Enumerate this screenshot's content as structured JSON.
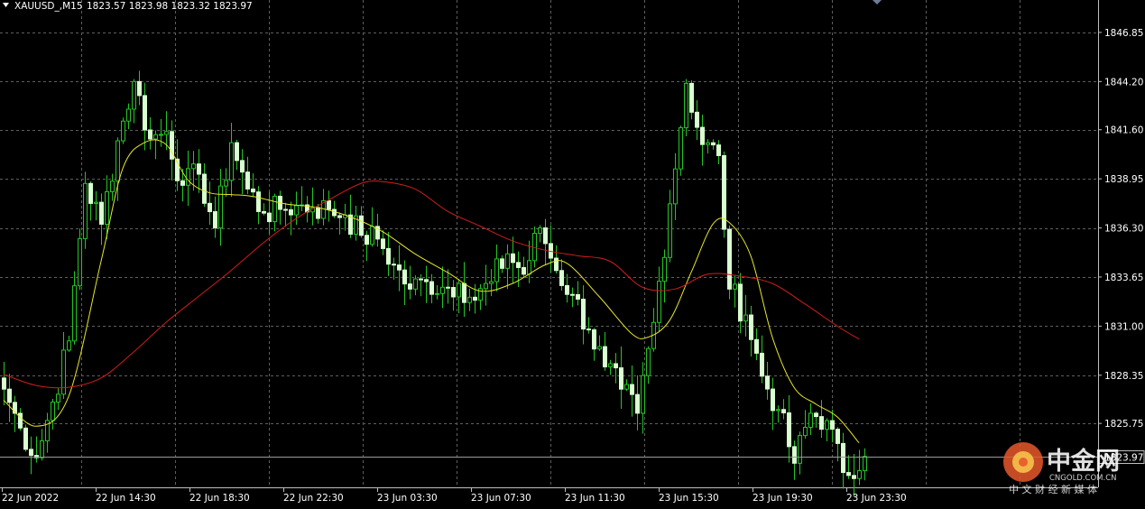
{
  "header": {
    "symbol_label": "XAUUSD_,M15",
    "ohlc_text": "1823.57 1823.98 1823.32 1823.97"
  },
  "colors": {
    "background": "#000000",
    "grid": "#5f5f5f",
    "up": "#22c622",
    "down": "#d9ffd0",
    "ma_fast": "#e6e62a",
    "ma_slow": "#d01d1d",
    "price_line": "#9a9a9a"
  },
  "watermark": {
    "name": "中金网",
    "domain": "CNGOLD.COM.CN",
    "slogan": "中 文 财 经 新 媒 体"
  },
  "chart_data": {
    "type": "candlestick",
    "symbol": "XAUUSD_",
    "timeframe": "M15",
    "y_ticks": [
      1846.85,
      1844.2,
      1841.6,
      1838.95,
      1836.3,
      1833.65,
      1831.0,
      1828.35,
      1825.75
    ],
    "y_tick_labels": [
      "1846.85",
      "1844.20",
      "1841.60",
      "1838.95",
      "1836.30",
      "1833.65",
      "1831.00",
      "1828.35",
      "1825.75"
    ],
    "ylim": [
      1822.3,
      1848.6
    ],
    "current_price": 1823.97,
    "current_price_label": "1823.97",
    "x_tick_labels": [
      "22 Jun 2022",
      "22 Jun 14:30",
      "22 Jun 18:30",
      "22 Jun 22:30",
      "23 Jun 03:30",
      "23 Jun 07:30",
      "23 Jun 11:30",
      "23 Jun 15:30",
      "23 Jun 19:30",
      "23 Jun 23:30"
    ],
    "candle_count": 160,
    "close_anchors": [
      [
        0,
        1827.6
      ],
      [
        3,
        1825.5
      ],
      [
        6,
        1823.9
      ],
      [
        9,
        1826.9
      ],
      [
        12,
        1830.2
      ],
      [
        15,
        1838.7
      ],
      [
        18,
        1836.5
      ],
      [
        21,
        1841.0
      ],
      [
        24,
        1844.2
      ],
      [
        27,
        1841.1
      ],
      [
        30,
        1841.5
      ],
      [
        33,
        1838.6
      ],
      [
        36,
        1839.2
      ],
      [
        39,
        1836.3
      ],
      [
        42,
        1840.9
      ],
      [
        45,
        1838.4
      ],
      [
        48,
        1837.1
      ],
      [
        51,
        1837.3
      ],
      [
        54,
        1837.5
      ],
      [
        57,
        1837.4
      ],
      [
        60,
        1837.3
      ],
      [
        63,
        1837.0
      ],
      [
        66,
        1835.9
      ],
      [
        69,
        1835.7
      ],
      [
        72,
        1834.3
      ],
      [
        75,
        1833.0
      ],
      [
        78,
        1833.4
      ],
      [
        81,
        1833.1
      ],
      [
        84,
        1833.3
      ],
      [
        87,
        1832.4
      ],
      [
        90,
        1833.4
      ],
      [
        93,
        1834.9
      ],
      [
        96,
        1833.8
      ],
      [
        99,
        1836.3
      ],
      [
        102,
        1834.0
      ],
      [
        105,
        1832.7
      ],
      [
        108,
        1830.8
      ],
      [
        111,
        1828.8
      ],
      [
        114,
        1827.6
      ],
      [
        117,
        1826.3
      ],
      [
        120,
        1831.2
      ],
      [
        123,
        1837.6
      ],
      [
        126,
        1844.1
      ],
      [
        129,
        1840.8
      ],
      [
        132,
        1840.2
      ],
      [
        134,
        1833.0
      ],
      [
        137,
        1831.6
      ],
      [
        140,
        1828.3
      ],
      [
        143,
        1826.5
      ],
      [
        146,
        1823.6
      ],
      [
        149,
        1826.3
      ],
      [
        152,
        1825.9
      ],
      [
        155,
        1823.1
      ],
      [
        159,
        1823.97
      ]
    ],
    "moving_averages": [
      {
        "style": "fast",
        "points": [
          [
            0,
            1827.0
          ],
          [
            6,
            1825.6
          ],
          [
            12,
            1827.2
          ],
          [
            18,
            1834.5
          ],
          [
            22,
            1839.5
          ],
          [
            26,
            1840.9
          ],
          [
            30,
            1840.8
          ],
          [
            34,
            1838.9
          ],
          [
            38,
            1838.2
          ],
          [
            42,
            1838.1
          ],
          [
            46,
            1838.0
          ],
          [
            52,
            1837.6
          ],
          [
            58,
            1837.4
          ],
          [
            64,
            1836.9
          ],
          [
            70,
            1836.1
          ],
          [
            76,
            1834.9
          ],
          [
            82,
            1833.9
          ],
          [
            88,
            1832.9
          ],
          [
            94,
            1833.3
          ],
          [
            100,
            1834.3
          ],
          [
            104,
            1834.4
          ],
          [
            110,
            1832.6
          ],
          [
            116,
            1830.6
          ],
          [
            119,
            1830.4
          ],
          [
            123,
            1831.3
          ],
          [
            127,
            1833.9
          ],
          [
            131,
            1836.5
          ],
          [
            134,
            1836.6
          ],
          [
            138,
            1834.8
          ],
          [
            142,
            1830.4
          ],
          [
            146,
            1827.7
          ],
          [
            150,
            1826.8
          ],
          [
            154,
            1826.1
          ],
          [
            158,
            1824.7
          ]
        ]
      },
      {
        "style": "slow",
        "points": [
          [
            0,
            1828.4
          ],
          [
            6,
            1827.8
          ],
          [
            12,
            1827.7
          ],
          [
            18,
            1828.2
          ],
          [
            24,
            1829.6
          ],
          [
            30,
            1831.2
          ],
          [
            36,
            1832.6
          ],
          [
            42,
            1834.0
          ],
          [
            48,
            1835.5
          ],
          [
            54,
            1836.8
          ],
          [
            60,
            1837.8
          ],
          [
            66,
            1838.7
          ],
          [
            70,
            1838.8
          ],
          [
            76,
            1838.4
          ],
          [
            82,
            1837.2
          ],
          [
            88,
            1836.4
          ],
          [
            94,
            1835.6
          ],
          [
            100,
            1835.1
          ],
          [
            106,
            1834.8
          ],
          [
            112,
            1834.5
          ],
          [
            118,
            1833.1
          ],
          [
            124,
            1833.0
          ],
          [
            130,
            1833.8
          ],
          [
            136,
            1833.7
          ],
          [
            142,
            1833.3
          ],
          [
            148,
            1832.2
          ],
          [
            154,
            1831.0
          ],
          [
            158,
            1830.3
          ]
        ]
      }
    ]
  }
}
